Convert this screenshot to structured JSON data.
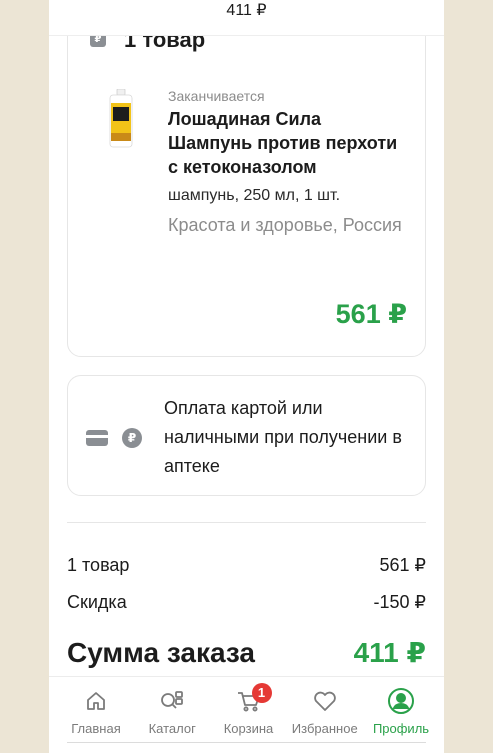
{
  "header": {
    "total": "411 ₽"
  },
  "order": {
    "items_count_label": "1 товар",
    "product": {
      "stock_status": "Заканчивается",
      "name": "Лошадиная Сила Шампунь против перхоти с кетоконазолом",
      "description": "шампунь, 250 мл, 1 шт.",
      "category": "Красота и здоровье, Россия",
      "price": "561 ₽"
    }
  },
  "payment": {
    "text": "Оплата картой или наличными при получении в аптеке",
    "icons": [
      "card-icon",
      "ruble-icon"
    ]
  },
  "summary": {
    "items_label": "1 товар",
    "items_value": "561 ₽",
    "discount_label": "Скидка",
    "discount_value": "-150 ₽",
    "total_label": "Сумма заказа",
    "total_value": "411 ₽"
  },
  "tabbar": {
    "tabs": [
      {
        "label": "Главная",
        "icon": "home-icon"
      },
      {
        "label": "Каталог",
        "icon": "catalog-icon"
      },
      {
        "label": "Корзина",
        "icon": "cart-icon",
        "badge": "1"
      },
      {
        "label": "Избранное",
        "icon": "heart-icon"
      },
      {
        "label": "Профиль",
        "icon": "profile-icon",
        "active": true
      }
    ]
  },
  "colors": {
    "accent": "#2aa14a",
    "badge": "#e53935",
    "muted": "#8c8c8c"
  }
}
